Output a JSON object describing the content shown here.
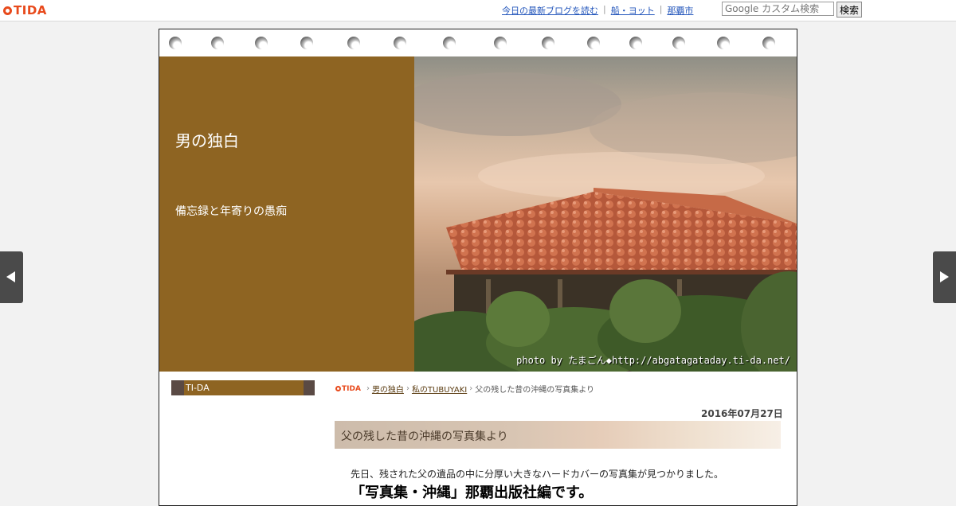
{
  "topbar": {
    "logo": "TIDA",
    "links": [
      "今日の最新ブログを読む",
      "船・ヨット",
      "那覇市"
    ],
    "search_placeholder": "Google カスタム検索",
    "search_button": "検索"
  },
  "header": {
    "title": "男の独白",
    "description": "備忘録と年寄りの愚痴",
    "photo_credit": "photo by たまごん◆http://abgatagataday.ti-da.net/"
  },
  "sidebar": {
    "box_label": "TI-DA"
  },
  "breadcrumb": {
    "logo": "TIDA",
    "items": [
      "男の独白",
      "私のTUBUYAKI"
    ],
    "current": "父の残した昔の沖縄の写真集より"
  },
  "entry": {
    "date": "2016年07月27日",
    "title": "父の残した昔の沖縄の写真集より",
    "body": "先日、残された父の遺品の中に分厚い大きなハードカバーの写真集が見つかりました。",
    "body_bold": "「写真集・沖縄」那覇出版社編です。"
  },
  "colors": {
    "brand": "#e84a1c",
    "header_brown": "#8e6422",
    "link": "#2255bb"
  }
}
